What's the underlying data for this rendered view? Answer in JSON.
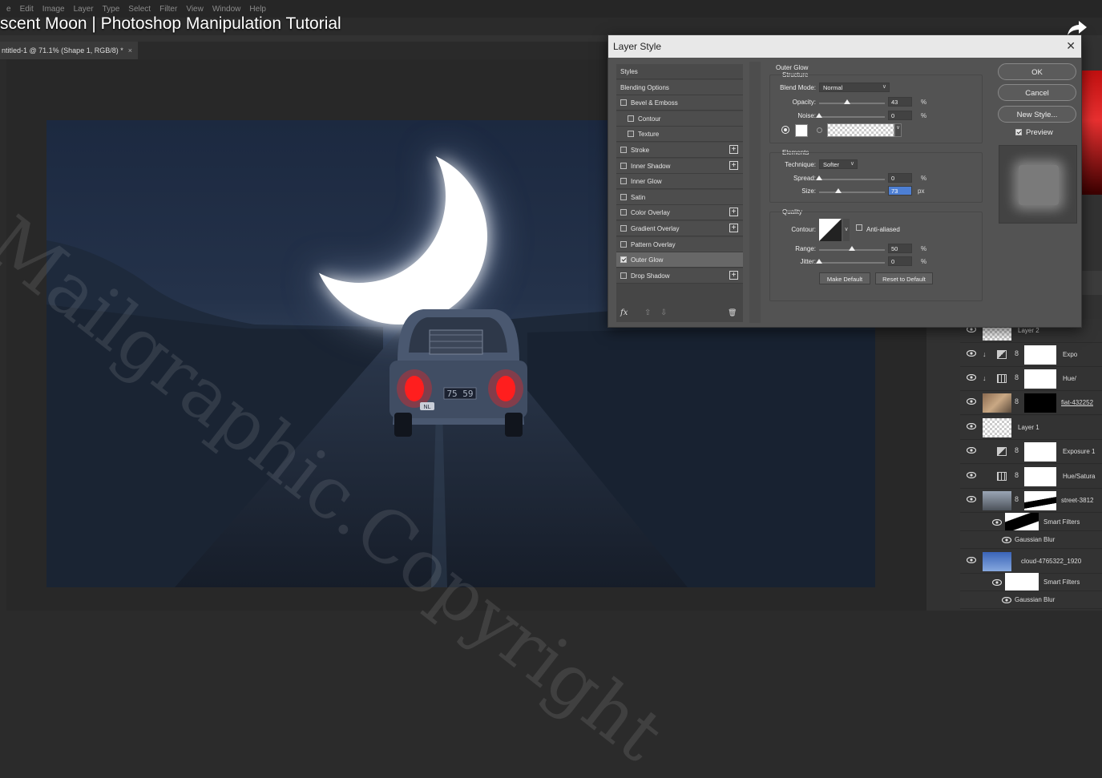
{
  "menu": [
    "e",
    "Edit",
    "Image",
    "Layer",
    "Type",
    "Select",
    "Filter",
    "View",
    "Window",
    "Help"
  ],
  "video_title": "scent Moon | Photoshop Manipulation Tutorial",
  "document_tab": {
    "label": "ntitled-1 @ 71.1% (Shape 1, RGB/8) *",
    "close": "×"
  },
  "dialog": {
    "title": "Layer Style",
    "close": "✕",
    "styles_header": "Styles",
    "blending_options": "Blending Options",
    "style_items": [
      {
        "label": "Bevel & Emboss",
        "checked": false,
        "plus": false
      },
      {
        "label": "Contour",
        "checked": false,
        "plus": false,
        "indent": true
      },
      {
        "label": "Texture",
        "checked": false,
        "plus": false,
        "indent": true
      },
      {
        "label": "Stroke",
        "checked": false,
        "plus": true
      },
      {
        "label": "Inner Shadow",
        "checked": false,
        "plus": true
      },
      {
        "label": "Inner Glow",
        "checked": false,
        "plus": false
      },
      {
        "label": "Satin",
        "checked": false,
        "plus": false
      },
      {
        "label": "Color Overlay",
        "checked": false,
        "plus": true
      },
      {
        "label": "Gradient Overlay",
        "checked": false,
        "plus": true
      },
      {
        "label": "Pattern Overlay",
        "checked": false,
        "plus": false
      },
      {
        "label": "Outer Glow",
        "checked": true,
        "plus": false,
        "selected": true
      },
      {
        "label": "Drop Shadow",
        "checked": false,
        "plus": true
      }
    ],
    "footer": {
      "fx": "fx",
      "up": "⇧",
      "down": "⇩",
      "trash": "🗑"
    },
    "settings": {
      "section_title": "Outer Glow",
      "structure": "Structure",
      "blend_mode_label": "Blend Mode:",
      "blend_mode_value": "Normal",
      "opacity_label": "Opacity:",
      "opacity_value": "43",
      "opacity_fraction": 0.43,
      "noise_label": "Noise:",
      "noise_value": "0",
      "noise_fraction": 0,
      "percent": "%",
      "elements": "Elements",
      "technique_label": "Technique:",
      "technique_value": "Softer",
      "spread_label": "Spread:",
      "spread_value": "0",
      "spread_fraction": 0,
      "size_label": "Size:",
      "size_value": "73",
      "size_fraction": 0.29,
      "px": "px",
      "quality": "Quality",
      "contour_label": "Contour:",
      "anti_aliased_label": "Anti-aliased",
      "range_label": "Range:",
      "range_value": "50",
      "range_fraction": 0.5,
      "jitter_label": "Jitter:",
      "jitter_value": "0",
      "jitter_fraction": 0,
      "make_default": "Make Default",
      "reset_default": "Reset to Default"
    },
    "buttons": {
      "ok": "OK",
      "cancel": "Cancel",
      "new_style": "New Style..."
    },
    "preview_label": "Preview",
    "preview_checked": true
  },
  "layers": [
    {
      "name": "Layer 2",
      "kind": "checker",
      "mask": false
    },
    {
      "name": "Expo",
      "kind": "adj-exposure",
      "mask": true,
      "clip": true
    },
    {
      "name": "Hue/",
      "kind": "adj-hue",
      "mask": true,
      "clip": true
    },
    {
      "name": "fiat-432252",
      "kind": "photo-car",
      "mask": "black",
      "underline": true
    },
    {
      "name": "Layer 1",
      "kind": "checker",
      "mask": false
    },
    {
      "name": "Exposure 1",
      "kind": "adj-exposure",
      "mask": true
    },
    {
      "name": "Hue/Satura",
      "kind": "adj-hue",
      "mask": true
    },
    {
      "name": "street-3812",
      "kind": "photo-street",
      "mask": "road"
    },
    {
      "name": "Smart Filters",
      "kind": "smart",
      "sub": true
    },
    {
      "name": "Gaussian Blur",
      "kind": "filter",
      "sub": true
    },
    {
      "name": "cloud-4765322_1920",
      "kind": "photo-sky",
      "mask": false
    },
    {
      "name": "Smart Filters",
      "kind": "smart-white",
      "sub": true
    },
    {
      "name": "Gaussian Blur",
      "kind": "filter",
      "sub": true
    }
  ],
  "license_plate": "75 59",
  "plate_badge": "NL",
  "watermark": "Mailgraphic.Copyright",
  "colors": {
    "dialog_bg": "#535353",
    "accent_blue": "#4d7fd4",
    "taillight": "#ff2020"
  }
}
